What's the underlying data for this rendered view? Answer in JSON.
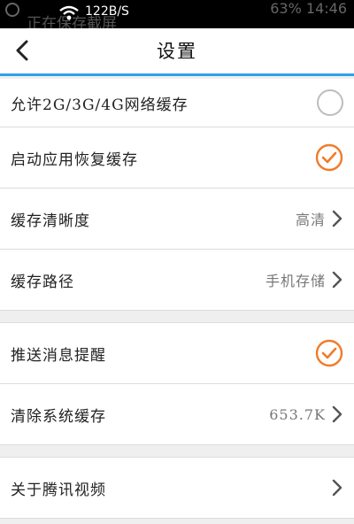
{
  "status_bar": {
    "network_speed": "122B/S",
    "ghost_text": "正在保存截屏",
    "right_text": "63% 14:46"
  },
  "header": {
    "title": "设置"
  },
  "settings": {
    "group1": [
      {
        "label": "允许2G/3G/4G网络缓存",
        "control": "checkbox",
        "checked": false
      },
      {
        "label": "启动应用恢复缓存",
        "control": "checkbox",
        "checked": true
      },
      {
        "label": "缓存清晰度",
        "value": "高清"
      },
      {
        "label": "缓存路径",
        "value": "手机存储"
      }
    ],
    "group2": [
      {
        "label": "推送消息提醒",
        "control": "checkbox",
        "checked": true
      },
      {
        "label": "清除系统缓存",
        "value": "653.7K"
      }
    ],
    "group3": [
      {
        "label": "关于腾讯视频"
      }
    ]
  },
  "colors": {
    "accent_orange": "#f07b2a",
    "header_line_blue": "#2e9ff0"
  },
  "icons": {
    "back": "chevron-left-icon",
    "arrow": "chevron-right-icon",
    "checked": "check-circle-icon",
    "unchecked": "circle-icon"
  }
}
